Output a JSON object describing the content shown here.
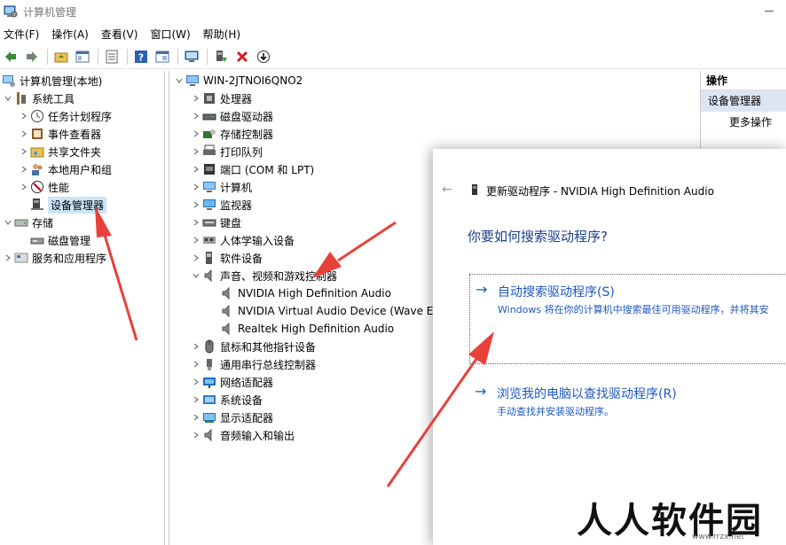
{
  "window": {
    "title": "计算机管理"
  },
  "menu": [
    "文件(F)",
    "操作(A)",
    "查看(V)",
    "窗口(W)",
    "帮助(H)"
  ],
  "left_tree": [
    {
      "label": "计算机管理(本地)",
      "chev": "",
      "indent": 0,
      "icon": "computer-management-icon"
    },
    {
      "label": "系统工具",
      "chev": "down",
      "indent": 1,
      "icon": "system-tools-icon"
    },
    {
      "label": "任务计划程序",
      "chev": "right",
      "indent": 2,
      "icon": "task-scheduler-icon"
    },
    {
      "label": "事件查看器",
      "chev": "right",
      "indent": 2,
      "icon": "event-viewer-icon"
    },
    {
      "label": "共享文件夹",
      "chev": "right",
      "indent": 2,
      "icon": "shared-folder-icon"
    },
    {
      "label": "本地用户和组",
      "chev": "right",
      "indent": 2,
      "icon": "users-icon"
    },
    {
      "label": "性能",
      "chev": "right",
      "indent": 2,
      "icon": "performance-icon"
    },
    {
      "label": "设备管理器",
      "chev": "",
      "indent": 2,
      "icon": "device-manager-icon",
      "selected": true
    },
    {
      "label": "存储",
      "chev": "down",
      "indent": 1,
      "icon": "storage-icon"
    },
    {
      "label": "磁盘管理",
      "chev": "",
      "indent": 2,
      "icon": "disk-icon"
    },
    {
      "label": "服务和应用程序",
      "chev": "right",
      "indent": 1,
      "icon": "services-icon"
    }
  ],
  "device_tree": {
    "root": "WIN-2JTNOI6QNO2",
    "items": [
      {
        "label": "处理器",
        "chev": "right",
        "indent": 1,
        "icon": "processor-icon"
      },
      {
        "label": "磁盘驱动器",
        "chev": "right",
        "indent": 1,
        "icon": "disk-drive-icon"
      },
      {
        "label": "存储控制器",
        "chev": "right",
        "indent": 1,
        "icon": "storage-controller-icon"
      },
      {
        "label": "打印队列",
        "chev": "right",
        "indent": 1,
        "icon": "printer-icon"
      },
      {
        "label": "端口 (COM 和 LPT)",
        "chev": "right",
        "indent": 1,
        "icon": "port-icon"
      },
      {
        "label": "计算机",
        "chev": "right",
        "indent": 1,
        "icon": "computer-icon"
      },
      {
        "label": "监视器",
        "chev": "right",
        "indent": 1,
        "icon": "monitor-icon"
      },
      {
        "label": "键盘",
        "chev": "right",
        "indent": 1,
        "icon": "keyboard-icon"
      },
      {
        "label": "人体学输入设备",
        "chev": "right",
        "indent": 1,
        "icon": "hid-icon"
      },
      {
        "label": "软件设备",
        "chev": "right",
        "indent": 1,
        "icon": "software-device-icon"
      },
      {
        "label": "声音、视频和游戏控制器",
        "chev": "down",
        "indent": 1,
        "icon": "speaker-icon"
      },
      {
        "label": "NVIDIA High Definition Audio",
        "chev": "",
        "indent": 2,
        "icon": "speaker-icon"
      },
      {
        "label": "NVIDIA Virtual Audio Device (Wave Ex",
        "chev": "",
        "indent": 2,
        "icon": "speaker-icon"
      },
      {
        "label": "Realtek High Definition Audio",
        "chev": "",
        "indent": 2,
        "icon": "speaker-icon"
      },
      {
        "label": "鼠标和其他指针设备",
        "chev": "right",
        "indent": 1,
        "icon": "mouse-icon"
      },
      {
        "label": "通用串行总线控制器",
        "chev": "right",
        "indent": 1,
        "icon": "usb-icon"
      },
      {
        "label": "网络适配器",
        "chev": "right",
        "indent": 1,
        "icon": "network-adapter-icon"
      },
      {
        "label": "系统设备",
        "chev": "right",
        "indent": 1,
        "icon": "system-device-icon"
      },
      {
        "label": "显示适配器",
        "chev": "right",
        "indent": 1,
        "icon": "display-adapter-icon"
      },
      {
        "label": "音频输入和输出",
        "chev": "right",
        "indent": 1,
        "icon": "speaker-icon"
      }
    ]
  },
  "actions_pane": {
    "header": "操作",
    "selected": "设备管理器",
    "more": "更多操作"
  },
  "dialog": {
    "title": "更新驱动程序 - NVIDIA High Definition Audio",
    "question": "你要如何搜索驱动程序?",
    "option1": {
      "title": "自动搜索驱动程序(S)",
      "desc": "Windows 将在你的计算机中搜索最佳可用驱动程序，并将其安"
    },
    "option2": {
      "title": "浏览我的电脑以查找驱动程序(R)",
      "desc": "手动查找并安装驱动程序。"
    }
  },
  "watermark": {
    "text": "人人软件园",
    "url": "www.rrzx.net"
  },
  "colors": {
    "selection": "#cce4f7",
    "link_blue": "#1e58c4",
    "question_blue": "#1e3f8a",
    "annotation_red": "#e8413a"
  }
}
